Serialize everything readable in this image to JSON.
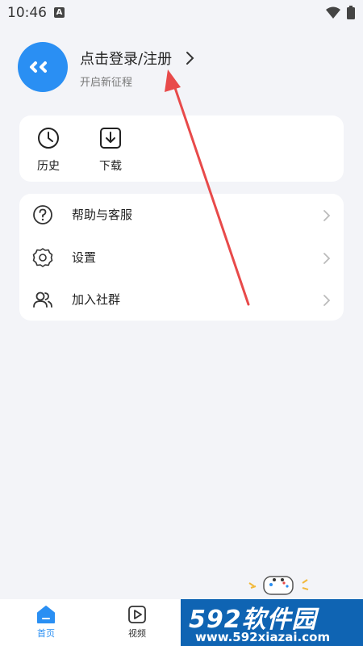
{
  "status_bar": {
    "time": "10:46",
    "notif_letter": "A"
  },
  "profile": {
    "login_title": "点击登录/注册",
    "subtitle": "开启新征程"
  },
  "quick_actions": [
    {
      "label": "历史",
      "icon": "clock-icon"
    },
    {
      "label": "下载",
      "icon": "download-icon"
    }
  ],
  "menu": [
    {
      "label": "帮助与客服",
      "icon": "help-circle-icon"
    },
    {
      "label": "设置",
      "icon": "gear-icon"
    },
    {
      "label": "加入社群",
      "icon": "group-icon"
    }
  ],
  "bottom_nav": [
    {
      "label": "首页",
      "icon": "home-icon",
      "active": true
    },
    {
      "label": "视频",
      "icon": "play-icon",
      "active": false
    }
  ],
  "watermark": {
    "brand": "592软件园",
    "url": "www.592xiazai.com"
  },
  "colors": {
    "accent": "#2a8ff3",
    "annotation": "#e84a4a",
    "watermark_bg": "#0f64b3"
  }
}
